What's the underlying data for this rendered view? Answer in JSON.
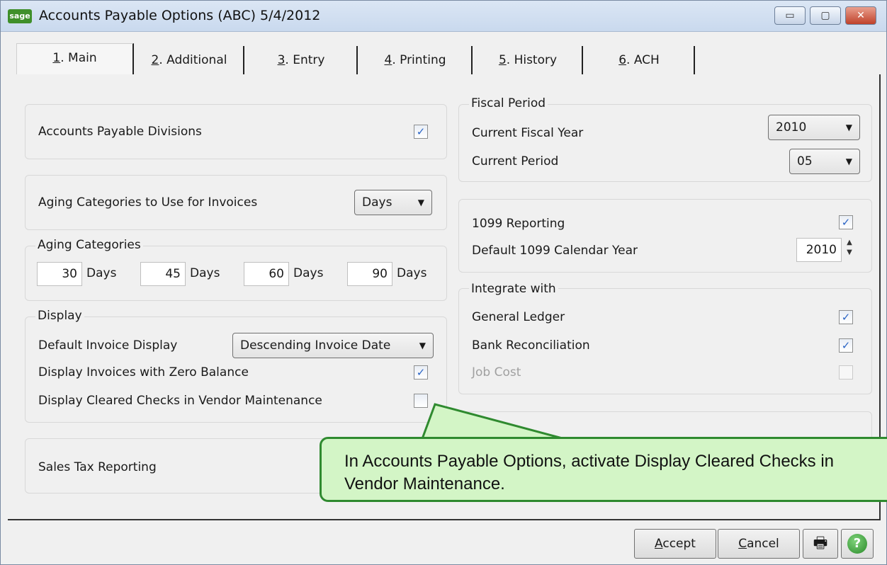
{
  "window": {
    "title": "Accounts Payable Options (ABC) 5/4/2012",
    "logo_text": "sage",
    "controls": {
      "minimize": "▭",
      "maximize": "▢",
      "close": "✕"
    }
  },
  "tabs": [
    {
      "key": "1",
      "label": ". Main",
      "active": true
    },
    {
      "key": "2",
      "label": ". Additional"
    },
    {
      "key": "3",
      "label": ". Entry"
    },
    {
      "key": "4",
      "label": ". Printing"
    },
    {
      "key": "5",
      "label": ". History"
    },
    {
      "key": "6",
      "label": ". ACH"
    }
  ],
  "left": {
    "divisions": {
      "label": "Accounts Payable Divisions",
      "checked": "✓"
    },
    "aging_use": {
      "label": "Aging Categories to Use for Invoices",
      "value": "Days"
    },
    "aging_categories": {
      "legend": "Aging Categories",
      "items": [
        {
          "value": "30",
          "unit": "Days"
        },
        {
          "value": "45",
          "unit": "Days"
        },
        {
          "value": "60",
          "unit": "Days"
        },
        {
          "value": "90",
          "unit": "Days"
        }
      ]
    },
    "display": {
      "legend": "Display",
      "default_invoice_label": "Default Invoice Display",
      "default_invoice_value": "Descending Invoice Date",
      "zero_balance_label": "Display Invoices with Zero Balance",
      "zero_balance_checked": "✓",
      "cleared_checks_label": "Display Cleared Checks in Vendor Maintenance",
      "cleared_checks_checked": ""
    },
    "sales_tax": {
      "label": "Sales Tax Reporting"
    }
  },
  "right": {
    "fiscal": {
      "legend": "Fiscal Period",
      "year_label": "Current Fiscal Year",
      "year_value": "2010",
      "period_label": "Current Period",
      "period_value": "05"
    },
    "reporting_1099": {
      "label": "1099 Reporting",
      "checked": "✓",
      "year_label": "Default 1099 Calendar Year",
      "year_value": "2010"
    },
    "integrate": {
      "legend": "Integrate with",
      "gl_label": "General Ledger",
      "gl_checked": "✓",
      "bank_label": "Bank Reconciliation",
      "bank_checked": "✓",
      "job_label": "Job Cost",
      "job_checked": ""
    }
  },
  "callout": {
    "text": "In Accounts Payable Options, activate Display Cleared Checks in Vendor Maintenance."
  },
  "footer": {
    "accept_label": "ccept",
    "accept_key": "A",
    "cancel_label": "ancel",
    "cancel_key": "C",
    "print_icon": "🖶",
    "help_icon": "?"
  }
}
